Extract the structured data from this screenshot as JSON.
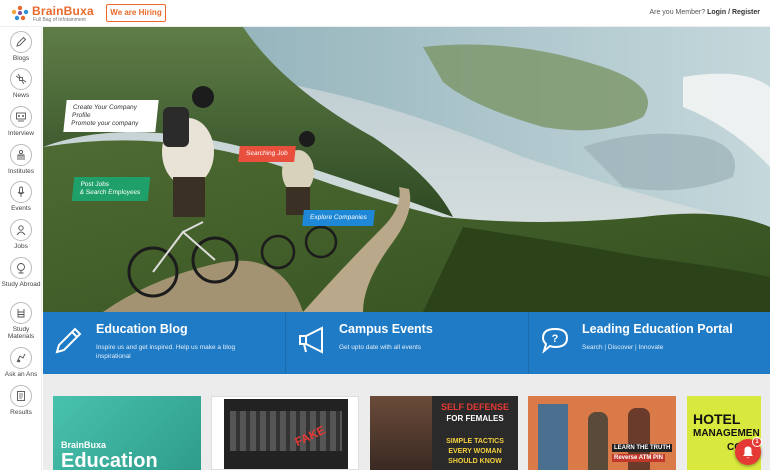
{
  "header": {
    "logo_name": "BrainBuxa",
    "logo_tagline": "Full Bag of Infotainment",
    "hiring_label": "We are Hiring",
    "member_prompt": "Are you Member?",
    "login_label": "Login",
    "separator": "/",
    "register_label": "Register"
  },
  "sidebar": {
    "items": [
      {
        "label": "Blogs",
        "icon": "pencil-icon"
      },
      {
        "label": "News",
        "icon": "satellite-icon"
      },
      {
        "label": "Interview",
        "icon": "interview-icon"
      },
      {
        "label": "Institutes",
        "icon": "institute-icon"
      },
      {
        "label": "Events",
        "icon": "microphone-icon"
      },
      {
        "label": "Jobs",
        "icon": "user-icon"
      },
      {
        "label": "Study Abroad",
        "icon": "globe-icon"
      },
      {
        "label": "Study Materials",
        "icon": "materials-icon"
      },
      {
        "label": "Ask an Ans",
        "icon": "ask-icon"
      },
      {
        "label": "Results",
        "icon": "results-icon"
      }
    ]
  },
  "hero": {
    "callout_company_1": "Create Your Company Profile",
    "callout_company_2": "Promote your company",
    "callout_search": "Searching Job",
    "callout_post_1": "Post Jobs",
    "callout_post_2": "& Search Employees",
    "callout_explore": "Explore Companies"
  },
  "features": [
    {
      "title": "Education Blog",
      "desc": "Inspire us and get inspired. Help us make a blog inspirational",
      "icon": "pencil-icon"
    },
    {
      "title": "Campus Events",
      "desc": "Get upto date with all events",
      "icon": "megaphone-icon"
    },
    {
      "title": "Leading Education Portal",
      "desc": "Search | Discover | Innovate",
      "icon": "speech-bubble-icon"
    }
  ],
  "cards": {
    "card1_brand": "BrainBuxa",
    "card1_title": "Education",
    "card2_stamp": "FAKE",
    "card3_title_1": "SELF DEFENSE",
    "card3_title_2": "FOR FEMALES",
    "card3_line_1": "SIMPLE TACTICS",
    "card3_line_2": "EVERY WOMAN",
    "card3_line_3": "SHOULD KNOW",
    "card4_line_1": "LEARN THE TRUTH",
    "card4_line_2": "Reverse ATM PIN",
    "card5_title_1": "HOTEL",
    "card5_title_2": "MANAGEMEN",
    "card5_title_3": "CO"
  },
  "chat": {
    "badge_count": "1"
  },
  "colors": {
    "brand": "#e8692b",
    "blue_bar": "#1f7bc6",
    "gray_strip": "#ececec"
  }
}
